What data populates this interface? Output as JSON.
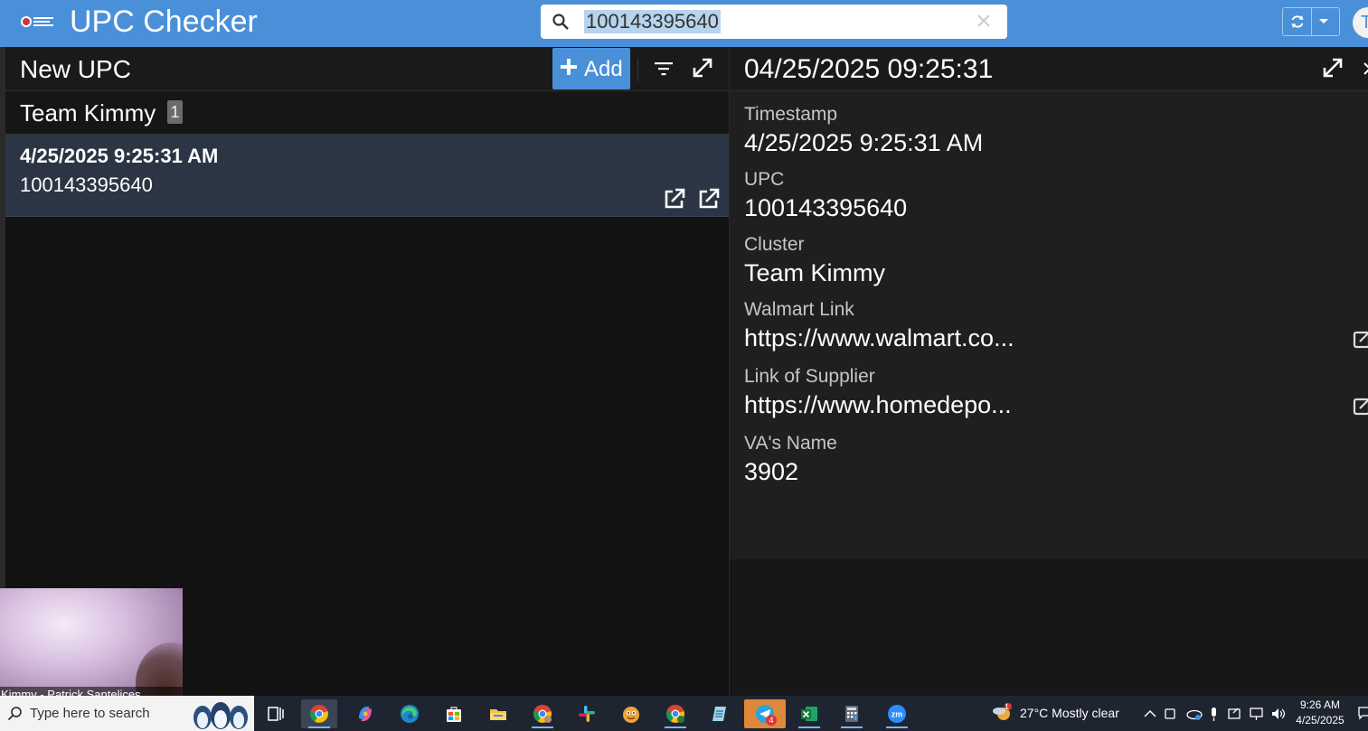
{
  "app": {
    "title": "UPC Checker",
    "accent_color": "#4a90d9"
  },
  "search": {
    "value": "100143395640",
    "icon": "search-icon",
    "clear_icon": "close-icon"
  },
  "header_actions": {
    "sync_icon": "sync-icon",
    "dropdown_icon": "caret-down-icon",
    "avatar_initial": "T"
  },
  "left_panel": {
    "title": "New UPC",
    "add_label": "Add",
    "group": {
      "name": "Team Kimmy",
      "count": "1"
    },
    "records": [
      {
        "date": "4/25/2025 9:25:31 AM",
        "upc": "100143395640"
      }
    ]
  },
  "detail": {
    "title": "04/25/2025 09:25:31",
    "fields": [
      {
        "label": "Timestamp",
        "value": "4/25/2025 9:25:31 AM"
      },
      {
        "label": "UPC",
        "value": "100143395640"
      },
      {
        "label": "Cluster",
        "value": "Team Kimmy"
      },
      {
        "label": "Walmart Link",
        "value": "https://www.walmart.co..."
      },
      {
        "label": "Link of Supplier",
        "value": "https://www.homedepo..."
      },
      {
        "label": "VA's Name",
        "value": "3902"
      }
    ]
  },
  "webcam": {
    "label": "Kimmy - Patrick Santelices"
  },
  "taskbar": {
    "search_placeholder": "Type here to search",
    "weather": "27°C  Mostly clear",
    "weather_badge": "1",
    "time": "9:26 AM",
    "date": "4/25/2025",
    "app_badge": "4",
    "apps": [
      "task-view-icon",
      "chrome-icon",
      "copilot-icon",
      "edge-icon",
      "store-icon",
      "file-explorer-icon",
      "chrome-icon",
      "slack-icon",
      "app-icon",
      "chrome-icon",
      "notepad-icon",
      "telegram-icon",
      "excel-icon",
      "calculator-icon",
      "zoom-icon"
    ]
  }
}
